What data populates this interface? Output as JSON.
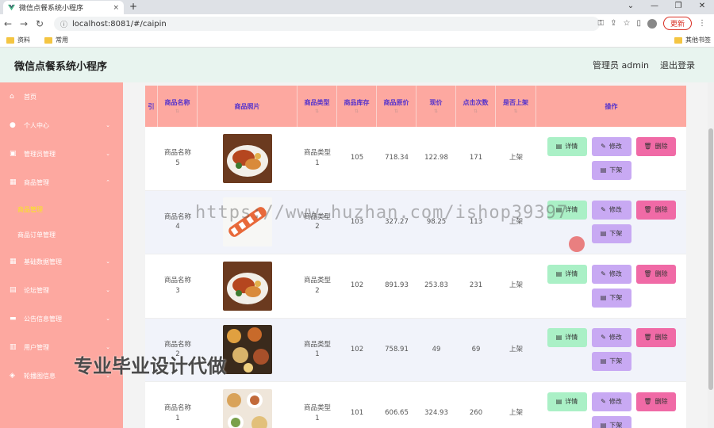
{
  "browser": {
    "tab_title": "微信点餐系统小程序",
    "tab_close": "×",
    "new_tab": "+",
    "url": "localhost:8081/#/caipin",
    "update_label": "更新",
    "bookmarks": [
      "资料",
      "常用"
    ],
    "other_bookmarks": "其他书签"
  },
  "header": {
    "title": "微信点餐系统小程序",
    "user": "管理员 admin",
    "logout": "退出登录"
  },
  "sidebar": {
    "items": [
      {
        "label": "首页",
        "icon": "home-icon"
      },
      {
        "label": "个人中心",
        "icon": "user-icon"
      },
      {
        "label": "管理员管理",
        "icon": "admin-icon"
      },
      {
        "label": "商品管理",
        "icon": "grid-icon"
      },
      {
        "label": "商品管理",
        "sub": true,
        "active": true
      },
      {
        "label": "商品订单管理",
        "sub": true
      },
      {
        "label": "基础数据管理",
        "icon": "grid-icon"
      },
      {
        "label": "论坛管理",
        "icon": "forum-icon"
      },
      {
        "label": "公告信息管理",
        "icon": "notice-icon"
      },
      {
        "label": "用户管理",
        "icon": "users-icon"
      },
      {
        "label": "轮播图信息",
        "icon": "image-icon"
      }
    ]
  },
  "table": {
    "columns": [
      "引",
      "商品名称",
      "商品照片",
      "商品类型",
      "商品库存",
      "商品原价",
      "现价",
      "点击次数",
      "是否上架",
      "操作"
    ],
    "rows": [
      {
        "name": "商品名称\n5",
        "type": "商品类型\n1",
        "stock": "105",
        "orig": "718.34",
        "price": "122.98",
        "clicks": "171",
        "status": "上架",
        "photo": "seafood"
      },
      {
        "name": "商品名称\n4",
        "type": "商品类型\n2",
        "stock": "103",
        "orig": "327.27",
        "price": "98.25",
        "clicks": "113",
        "status": "上架",
        "photo": "sushi"
      },
      {
        "name": "商品名称\n3",
        "type": "商品类型\n2",
        "stock": "102",
        "orig": "891.93",
        "price": "253.83",
        "clicks": "231",
        "status": "上架",
        "photo": "seafood"
      },
      {
        "name": "商品名称\n2",
        "type": "商品类型\n1",
        "stock": "102",
        "orig": "758.91",
        "price": "49",
        "clicks": "69",
        "status": "上架",
        "photo": "platter"
      },
      {
        "name": "商品名称\n1",
        "type": "商品类型\n1",
        "stock": "101",
        "orig": "606.65",
        "price": "324.93",
        "clicks": "260",
        "status": "上架",
        "photo": "dishes"
      }
    ],
    "ops": {
      "detail": "详情",
      "edit": "修改",
      "delete": "删除",
      "off": "下架"
    }
  },
  "overlays": {
    "watermark": "https://www.huzhan.com/ishop39397",
    "promo": "专业毕业设计代做"
  },
  "colors": {
    "sidebar": "#fda8a0",
    "header_row": "#fda8a0",
    "header_text": "#5533cc",
    "active_sub": "#f8e71c",
    "btn_detail": "#aaf0c6",
    "btn_edit": "#c8a9f3",
    "btn_delete": "#f06aa6"
  }
}
